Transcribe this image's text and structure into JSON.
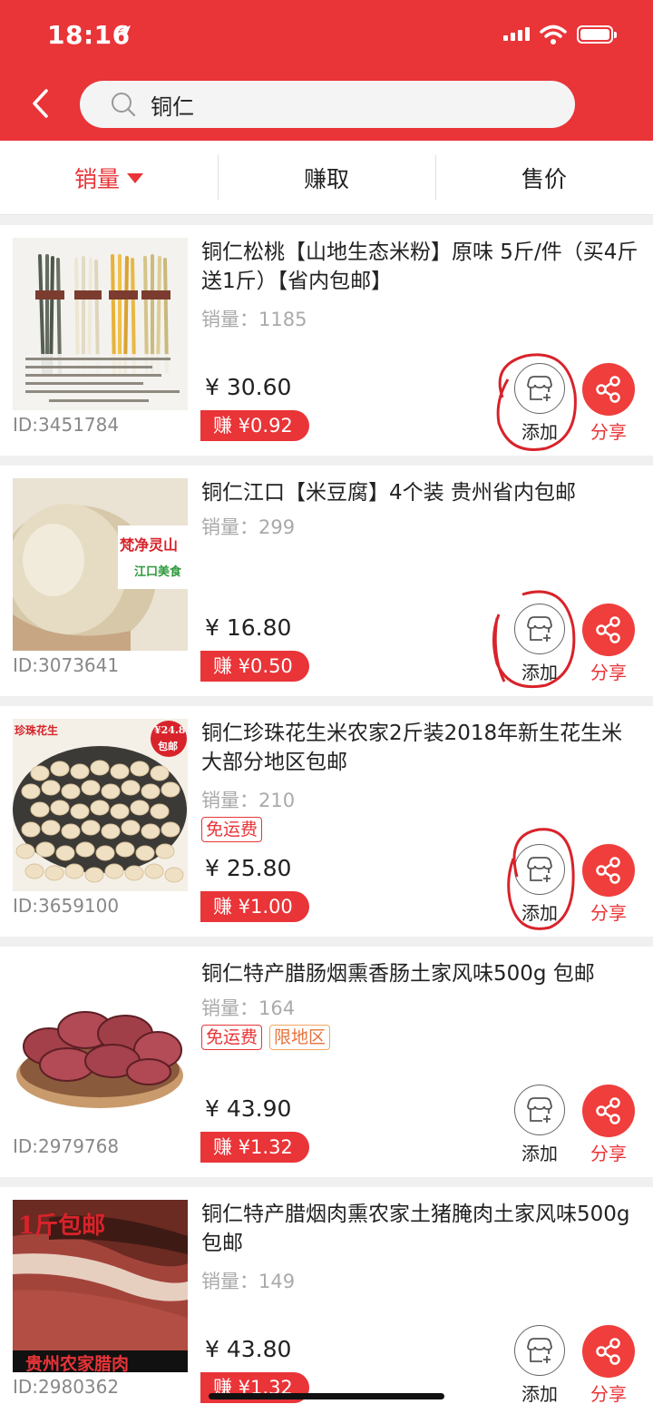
{
  "status_bar": {
    "time": "18:16"
  },
  "search": {
    "query": "铜仁"
  },
  "sort_tabs": [
    {
      "label": "销量",
      "active": true
    },
    {
      "label": "赚取",
      "active": false
    },
    {
      "label": "售价",
      "active": false
    }
  ],
  "labels": {
    "sales_prefix": "销量：",
    "add": "添加",
    "share": "分享"
  },
  "products": [
    {
      "title": "铜仁松桃【山地生态米粉】原味 5斤/件（买4斤送1斤）【省内包邮】",
      "sales": "1185",
      "tags": [],
      "price": "¥ 30.60",
      "earn": "赚 ¥0.92",
      "id": "ID:3451784"
    },
    {
      "title": "铜仁江口【米豆腐】4个装 贵州省内包邮",
      "sales": "299",
      "tags": [],
      "price": "¥ 16.80",
      "earn": "赚 ¥0.50",
      "id": "ID:3073641",
      "image_text": [
        "梵净灵山",
        "江口美食"
      ]
    },
    {
      "title": "铜仁珍珠花生米农家2斤装2018年新生花生米 大部分地区包邮",
      "sales": "210",
      "tags": [
        "免运费"
      ],
      "price": "¥ 25.80",
      "earn": "赚 ¥1.00",
      "id": "ID:3659100",
      "image_text": [
        "珍珠花生",
        "¥24.8",
        "包邮"
      ]
    },
    {
      "title": "铜仁特产腊肠烟熏香肠土家风味500g 包邮",
      "sales": "164",
      "tags": [
        "免运费",
        "限地区"
      ],
      "price": "¥ 43.90",
      "earn": "赚 ¥1.32",
      "id": "ID:2979768"
    },
    {
      "title": "铜仁特产腊烟肉熏农家土猪腌肉土家风味500g 包邮",
      "sales": "149",
      "tags": [],
      "price": "¥ 43.80",
      "earn": "赚 ¥1.32",
      "id": "ID:2980362",
      "image_text": [
        "1斤包邮",
        "贵州农家腊肉"
      ]
    }
  ],
  "colors": {
    "brand_red": "#e93438",
    "annotation_red": "#d8232a"
  },
  "icons": [
    "back-arrow",
    "search",
    "store-add",
    "share"
  ]
}
